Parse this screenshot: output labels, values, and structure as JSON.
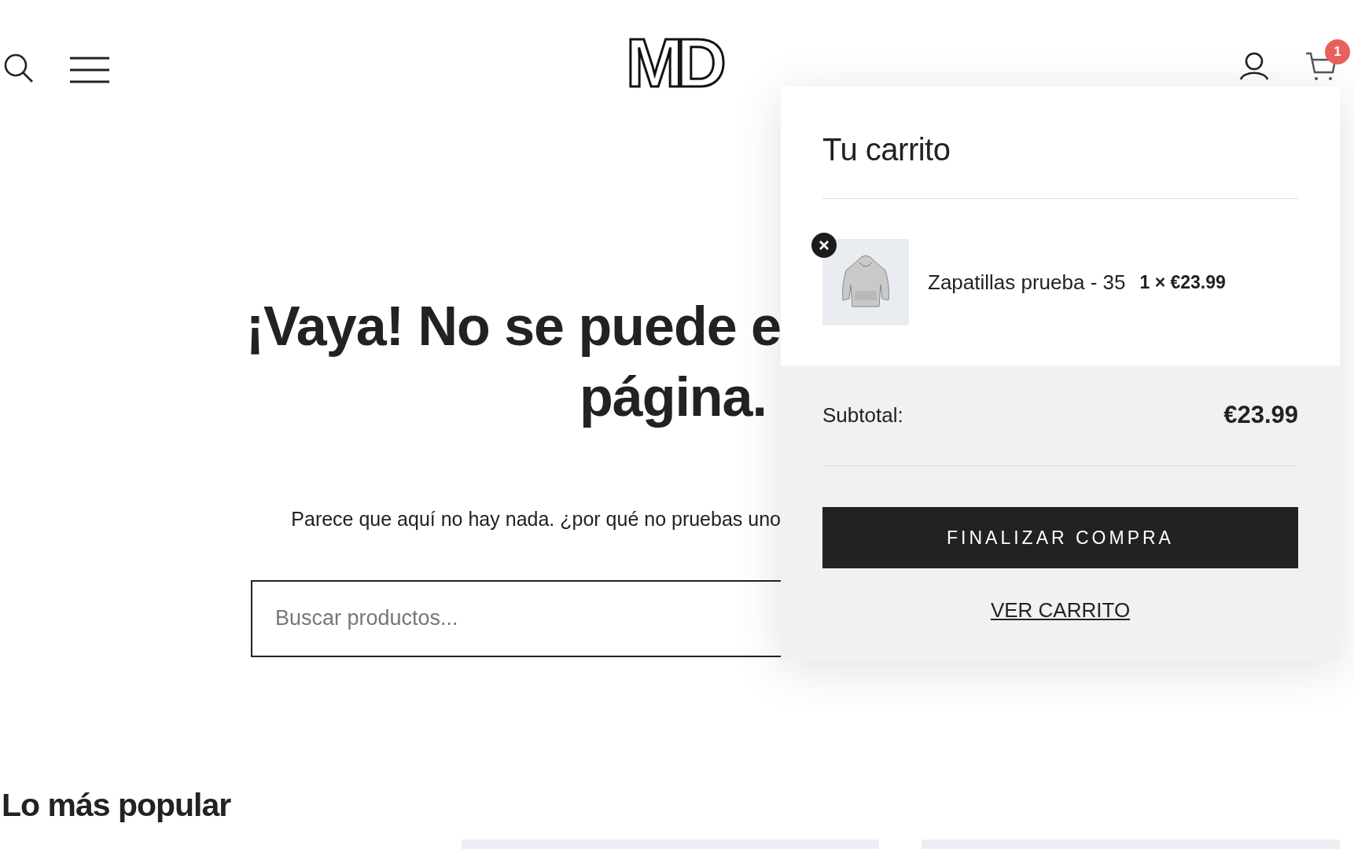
{
  "header": {
    "logo": "MD",
    "cart_count": "1"
  },
  "page": {
    "heading_lines": [
      "¡Vaya! No se puede e",
      "página."
    ],
    "message": "Parece que aquí no hay nada. ¿por qué no pruebas uno",
    "search": {
      "placeholder": "Buscar productos..."
    }
  },
  "popular": {
    "title": "Lo más popular"
  },
  "cart": {
    "title": "Tu carrito",
    "items": [
      {
        "name": "Zapatillas prueba - 35",
        "quantity_price": "1 × €23.99"
      }
    ],
    "subtotal_label": "Subtotal:",
    "subtotal": "€23.99",
    "checkout": "FINALIZAR COMPRA",
    "view_cart": "VER CARRITO"
  }
}
